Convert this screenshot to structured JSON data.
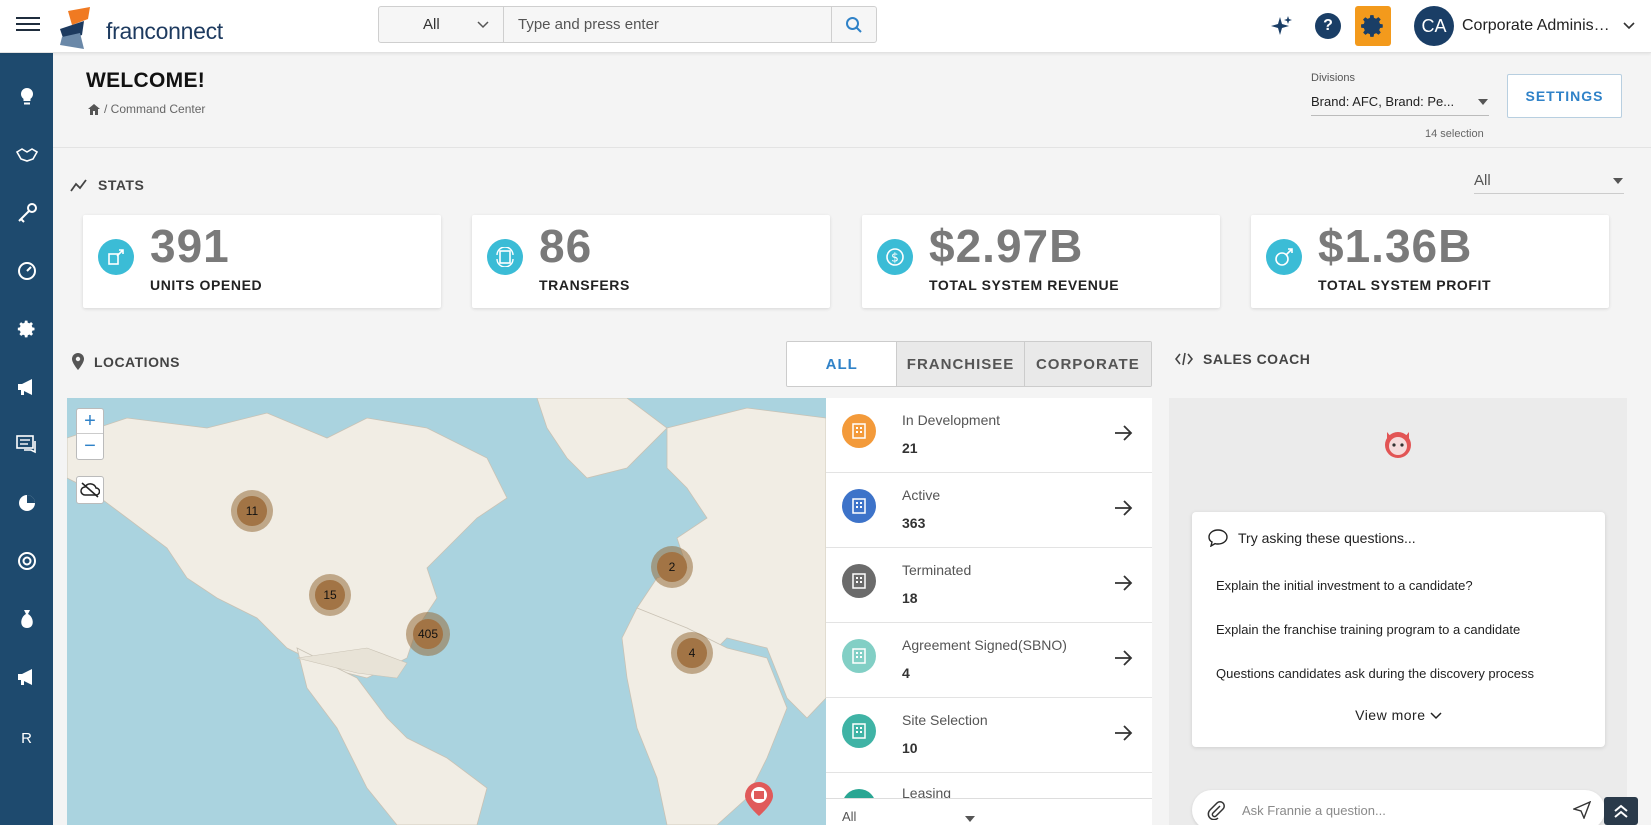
{
  "topbar": {
    "logo_text": "franconnect",
    "search_scope": "All",
    "search_placeholder": "Type and press enter",
    "avatar_initials": "CA",
    "user_name": "Corporate Administr..."
  },
  "sidebar": {
    "items": [
      "lightbulb-icon",
      "handshake-icon",
      "key-icon",
      "gauge-icon",
      "gear-icon",
      "megaphone-icon",
      "chat-icon",
      "pie-icon",
      "lifebuoy-icon",
      "money-bag-icon",
      "megaphone-icon"
    ],
    "letter": "R"
  },
  "header": {
    "title": "WELCOME!",
    "breadcrumb": "/ Command Center",
    "divisions_label": "Divisions",
    "divisions_value": "Brand: AFC, Brand: Pe...",
    "divisions_count": "14 selection",
    "settings_label": "SETTINGS"
  },
  "stats": {
    "title": "STATS",
    "filter": "All",
    "cards": [
      {
        "value": "391",
        "label": "UNITS OPENED"
      },
      {
        "value": "86",
        "label": "TRANSFERS"
      },
      {
        "value": "$2.97B",
        "label": "TOTAL SYSTEM REVENUE"
      },
      {
        "value": "$1.36B",
        "label": "TOTAL SYSTEM PROFIT"
      }
    ]
  },
  "locations": {
    "title": "LOCATIONS",
    "tabs": [
      "ALL",
      "FRANCHISEE",
      "CORPORATE"
    ],
    "clusters": [
      "11",
      "15",
      "405",
      "2",
      "4"
    ],
    "statuses": [
      {
        "name": "In Development",
        "count": "21",
        "color": "#f39a3a"
      },
      {
        "name": "Active",
        "count": "363",
        "color": "#3d73c9"
      },
      {
        "name": "Terminated",
        "count": "18",
        "color": "#6b6b6b"
      },
      {
        "name": "Agreement Signed(SBNO)",
        "count": "4",
        "color": "#82cfc5"
      },
      {
        "name": "Site Selection",
        "count": "10",
        "color": "#3fb3a5"
      },
      {
        "name": "Leasing",
        "count": "",
        "color": "#2aa693"
      }
    ],
    "footer_filter": "All"
  },
  "coach": {
    "title": "SALES COACH",
    "prompt_heading": "Try asking these questions...",
    "questions": [
      "Explain the initial investment to a candidate?",
      "Explain the franchise training program to a candidate",
      "Questions candidates ask during the discovery process"
    ],
    "view_more": "View more",
    "ask_placeholder": "Ask Frannie a question..."
  },
  "colors": {
    "sidebar": "#1e4a6e",
    "accent": "#2f82c8",
    "orange": "#f39a1c",
    "stat_icon": "#3bbcd6"
  }
}
